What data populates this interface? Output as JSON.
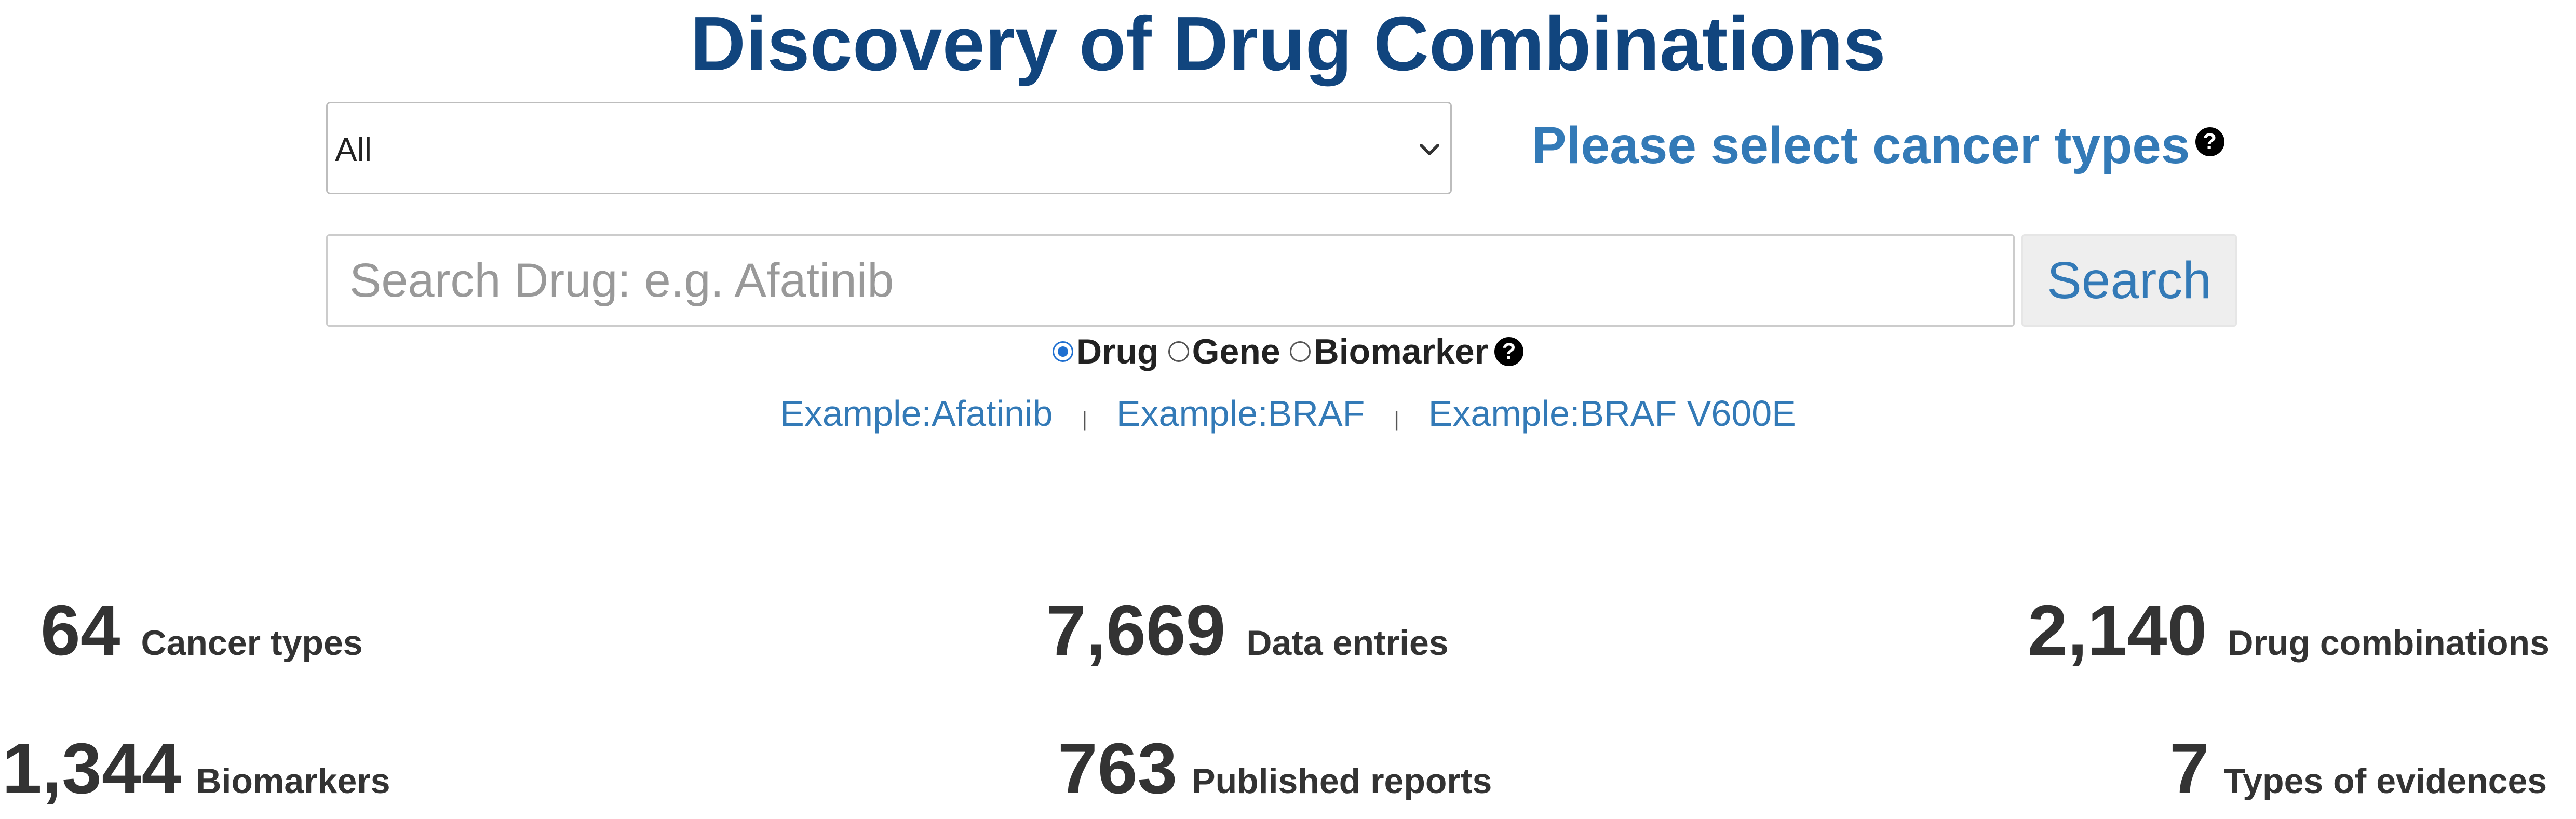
{
  "header": {
    "title": "Discovery of Drug Combinations"
  },
  "cancer_filter": {
    "selected": "All",
    "label": "Please select cancer types",
    "help_icon": "question-circle-icon"
  },
  "search": {
    "placeholder": "Search Drug: e.g. Afatinib",
    "value": "",
    "button_label": "Search"
  },
  "search_type": {
    "options": [
      {
        "label": "Drug",
        "checked": true
      },
      {
        "label": "Gene",
        "checked": false
      },
      {
        "label": "Biomarker",
        "checked": false
      }
    ],
    "help_icon": "question-circle-icon"
  },
  "examples": [
    "Example:Afatinib",
    "Example:BRAF",
    "Example:BRAF V600E"
  ],
  "examples_separator": "|",
  "stats": [
    {
      "value": "64",
      "label": "Cancer types"
    },
    {
      "value": "7,669",
      "label": "Data entries"
    },
    {
      "value": "2,140",
      "label": "Drug combinations"
    },
    {
      "value": "1,344",
      "label": "Biomarkers"
    },
    {
      "value": "763",
      "label": "Published reports"
    },
    {
      "value": "7",
      "label": "Types of evidences"
    }
  ],
  "colors": {
    "title": "#11457e",
    "link": "#337ab7",
    "text": "#333333",
    "radio_checked": "#1e6fd0"
  }
}
